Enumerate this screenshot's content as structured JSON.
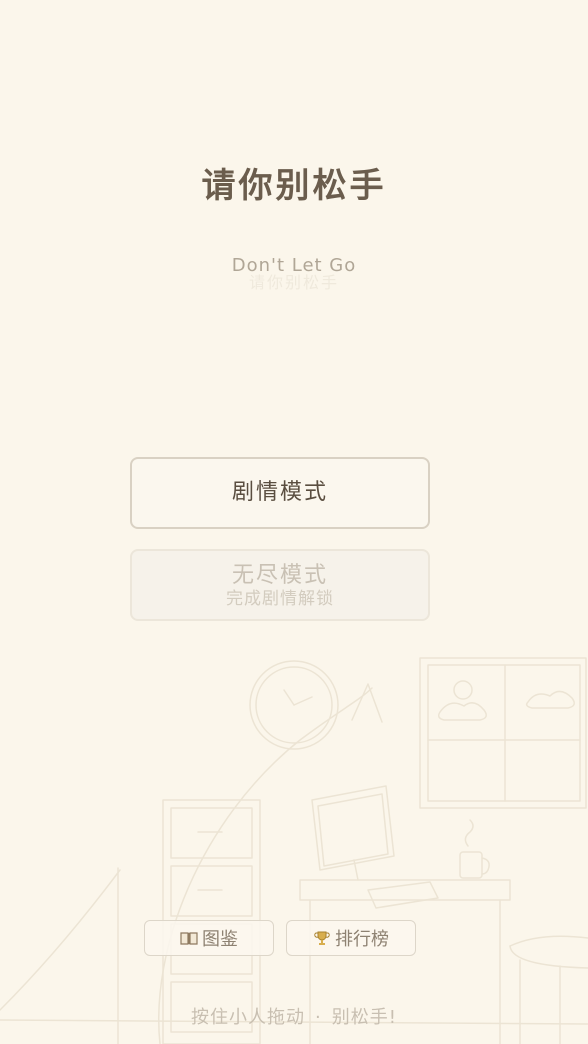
{
  "title": "请你别松手",
  "subtitle": "Don't Let Go",
  "subtitle_ghost": "请你别松手",
  "modes": {
    "story": {
      "label": "剧情模式"
    },
    "endless": {
      "label": "无尽模式",
      "locked_hint": "完成剧情解锁"
    }
  },
  "bottom_buttons": {
    "collection": {
      "label": "图鉴",
      "icon": "book-icon"
    },
    "leaderboard": {
      "label": "排行榜",
      "icon": "trophy-icon"
    }
  },
  "footer": {
    "left": "按住小人拖动",
    "separator": "·",
    "right": "别松手!"
  },
  "colors": {
    "background": "#fbf6eb",
    "title": "#6b5d4d",
    "button_border": "#d9d1c3",
    "locked_text": "#c9c1b4",
    "trophy": "#c9a14a",
    "book": "#b39a7a"
  }
}
